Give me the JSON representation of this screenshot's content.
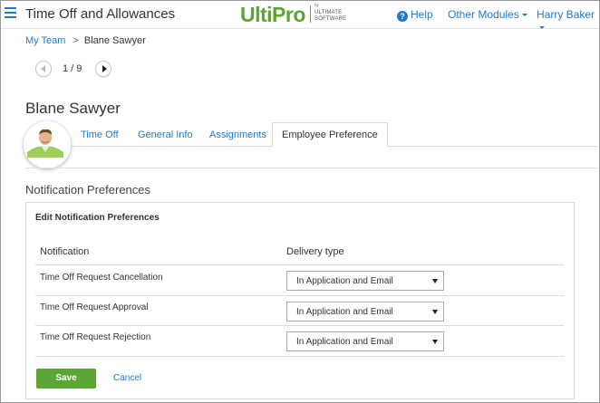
{
  "header": {
    "app_title": "Time Off and Allowances",
    "logo_text": "UltiPro",
    "logo_by": "by",
    "logo_company_line1": "ULTIMATE",
    "logo_company_line2": "SOFTWARE",
    "help_label": "Help",
    "other_modules_label": "Other Modules",
    "user_name": "Harry Baker",
    "brand_color": "#5aa533",
    "link_color": "#1f7bc9"
  },
  "breadcrumb": {
    "parent": "My Team",
    "separator": ">",
    "current": "Blane Sawyer"
  },
  "pager": {
    "current": 1,
    "total": 9,
    "text": "1 / 9"
  },
  "employee": {
    "name": "Blane Sawyer"
  },
  "tabs": [
    {
      "label": "Time Off",
      "active": false
    },
    {
      "label": "General Info",
      "active": false
    },
    {
      "label": "Assignments",
      "active": false
    },
    {
      "label": "Employee Preference",
      "active": true
    }
  ],
  "section": {
    "title": "Notification Preferences"
  },
  "card": {
    "title": "Edit Notification Preferences",
    "col_notification": "Notification",
    "col_delivery": "Delivery type",
    "rows": [
      {
        "notification": "Time Off Request Cancellation",
        "delivery": "In Application and Email"
      },
      {
        "notification": "Time Off Request Approval",
        "delivery": "In Application and Email"
      },
      {
        "notification": "Time Off Request Rejection",
        "delivery": "In Application and Email"
      }
    ],
    "save_label": "Save",
    "cancel_label": "Cancel"
  }
}
